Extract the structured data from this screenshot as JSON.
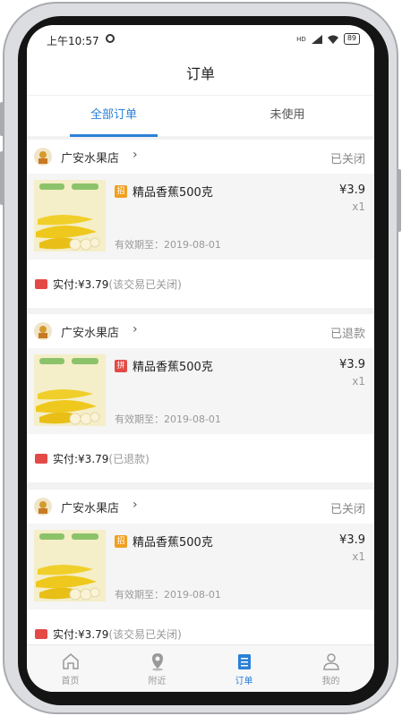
{
  "status_bar": {
    "time": "上午10:57",
    "network": "HD",
    "battery": "89"
  },
  "header": {
    "title": "订单"
  },
  "tabs": [
    {
      "label": "全部订单",
      "active": true
    },
    {
      "label": "未使用",
      "active": false
    }
  ],
  "orders": [
    {
      "shop": "广安水果店",
      "status": "已关闭",
      "badge": "招",
      "badge_color": "#f0a020",
      "item": "精品香蕉500克",
      "price": "¥3.9",
      "qty": "x1",
      "expiry": "有效期至：2019-08-01",
      "paid": "实付:¥3.79",
      "paid_note": "(该交易已关闭)"
    },
    {
      "shop": "广安水果店",
      "status": "已退款",
      "badge": "拼",
      "badge_color": "#e34a46",
      "item": "精品香蕉500克",
      "price": "¥3.9",
      "qty": "x1",
      "expiry": "有效期至：2019-08-01",
      "paid": "实付:¥3.79",
      "paid_note": "(已退款)"
    },
    {
      "shop": "广安水果店",
      "status": "已关闭",
      "badge": "招",
      "badge_color": "#f0a020",
      "item": "精品香蕉500克",
      "price": "¥3.9",
      "qty": "x1",
      "expiry": "有效期至：2019-08-01",
      "paid": "实付:¥3.79",
      "paid_note": "(该交易已关闭)"
    }
  ],
  "tabbar": [
    {
      "label": "首页",
      "icon": "home-icon",
      "active": false
    },
    {
      "label": "附近",
      "icon": "location-pin-icon",
      "active": false
    },
    {
      "label": "订单",
      "icon": "order-list-icon",
      "active": true
    },
    {
      "label": "我的",
      "icon": "user-icon",
      "active": false
    }
  ],
  "colors": {
    "accent": "#2a80d8",
    "ticket": "#e34a46"
  }
}
